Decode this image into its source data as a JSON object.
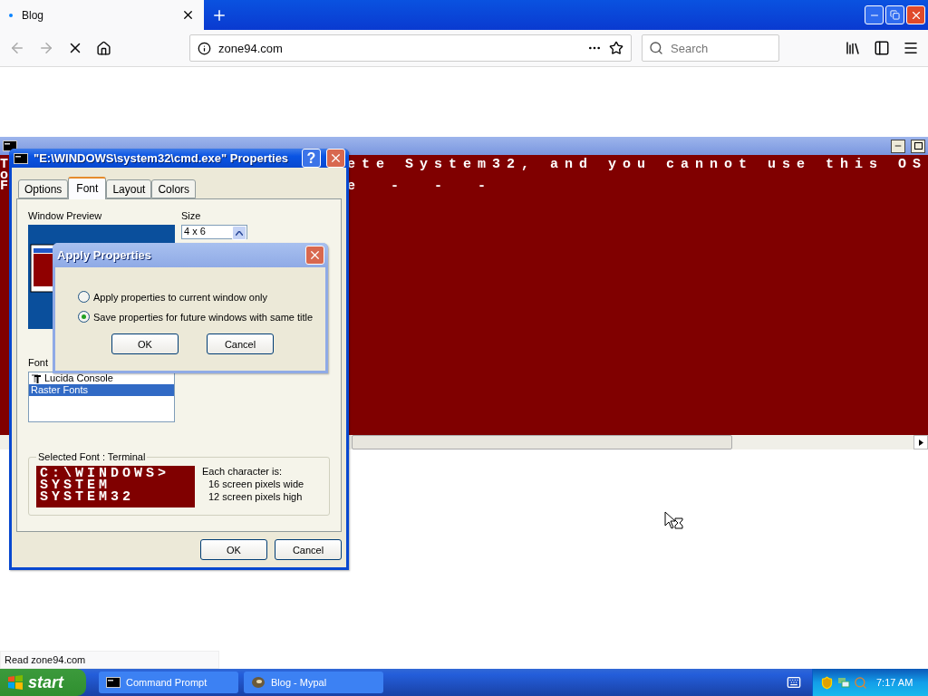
{
  "browser": {
    "tab": {
      "title": "Blog"
    },
    "url": "zone94.com",
    "search": {
      "placeholder": "Search"
    },
    "status": "Read zone94.com"
  },
  "console": {
    "lines": [
      {
        "left": "T",
        "right": "ete System32, and you cannot use this OS"
      },
      {
        "left": "o"
      },
      {
        "left": "F",
        "right": "e  -  -  -"
      }
    ]
  },
  "properties": {
    "title": "\"E:\\WINDOWS\\system32\\cmd.exe\" Properties",
    "help": "?",
    "tabs": [
      {
        "label": "Options",
        "selected": false
      },
      {
        "label": "Font",
        "selected": true
      },
      {
        "label": "Layout",
        "selected": false
      },
      {
        "label": "Colors",
        "selected": false
      }
    ],
    "preview_label": "Window Preview",
    "size_label": "Size",
    "sizes": [
      {
        "label": "4 x 6",
        "selected": false
      }
    ],
    "font_label": "Font",
    "fonts": [
      {
        "label": "Lucida Console",
        "kind": "truetype",
        "selected": false
      },
      {
        "label": "Raster Fonts",
        "kind": "raster",
        "selected": true
      }
    ],
    "selected_font_label": "Selected Font : Terminal",
    "sample_lines": [
      "C:\\WINDOWS>",
      "SYSTEM",
      "SYSTEM32"
    ],
    "char_info": [
      "Each character is:",
      "16 screen pixels wide",
      "12 screen pixels high"
    ],
    "buttons": [
      "OK",
      "Cancel"
    ]
  },
  "apply": {
    "title": "Apply Properties",
    "options": [
      {
        "label": "Apply properties to current window only",
        "selected": false
      },
      {
        "label": "Save properties for future windows with same title",
        "selected": true
      }
    ],
    "buttons": [
      "OK",
      "Cancel"
    ]
  },
  "taskbar": {
    "start": "start",
    "tasks": [
      {
        "label": "Command Prompt",
        "kind": "console"
      },
      {
        "label": "Blog - Mypal",
        "kind": "browser"
      }
    ],
    "clock": "7:17 AM"
  }
}
